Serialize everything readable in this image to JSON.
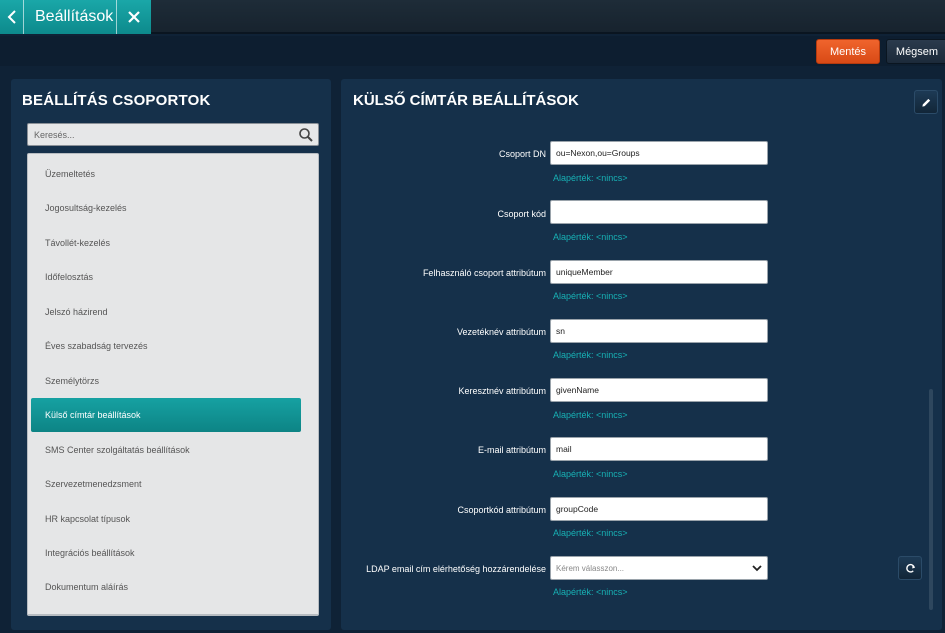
{
  "tab": {
    "title": "Beállítások"
  },
  "actions": {
    "save_label": "Mentés",
    "cancel_label": "Mégsem"
  },
  "left_panel": {
    "title": "BEÁLLÍTÁS CSOPORTOK",
    "search_placeholder": "Keresés...",
    "items": [
      {
        "label": "Üzemeltetés",
        "active": false
      },
      {
        "label": "Jogosultság-kezelés",
        "active": false
      },
      {
        "label": "Távollét-kezelés",
        "active": false
      },
      {
        "label": "Időfelosztás",
        "active": false
      },
      {
        "label": "Jelszó házirend",
        "active": false
      },
      {
        "label": "Éves szabadság tervezés",
        "active": false
      },
      {
        "label": "Személytörzs",
        "active": false
      },
      {
        "label": "Külső címtár beállítások",
        "active": true
      },
      {
        "label": "SMS Center szolgáltatás beállítások",
        "active": false
      },
      {
        "label": "Szervezetmenedzsment",
        "active": false
      },
      {
        "label": "HR kapcsolat típusok",
        "active": false
      },
      {
        "label": "Integrációs beállítások",
        "active": false
      },
      {
        "label": "Dokumentum aláírás",
        "active": false
      }
    ]
  },
  "right_panel": {
    "title": "KÜLSŐ CÍMTÁR BEÁLLÍTÁSOK",
    "fields": [
      {
        "label": "Csoport DN",
        "value": "ou=Nexon,ou=Groups",
        "default": "Alapérték: <nincs>"
      },
      {
        "label": "Csoport kód",
        "value": "",
        "default": "Alapérték: <nincs>"
      },
      {
        "label": "Felhasználó csoport attribútum",
        "value": "uniqueMember",
        "default": "Alapérték: <nincs>"
      },
      {
        "label": "Vezetéknév attribútum",
        "value": "sn",
        "default": "Alapérték: <nincs>"
      },
      {
        "label": "Keresztnév attribútum",
        "value": "givenName",
        "default": "Alapérték: <nincs>"
      },
      {
        "label": "E-mail attribútum",
        "value": "mail",
        "default": "Alapérték: <nincs>"
      },
      {
        "label": "Csoportkód attribútum",
        "value": "groupCode",
        "default": "Alapérték: <nincs>"
      }
    ],
    "select_field": {
      "label": "LDAP email cím elérhetőség hozzárendelése",
      "placeholder": "Kérem válasszon...",
      "default": "Alapérték: <nincs>"
    }
  },
  "colors": {
    "accent_teal": "#0d8a8c",
    "save_orange": "#e4541f",
    "panel_bg": "#15304a",
    "default_text": "#17b0b4"
  }
}
